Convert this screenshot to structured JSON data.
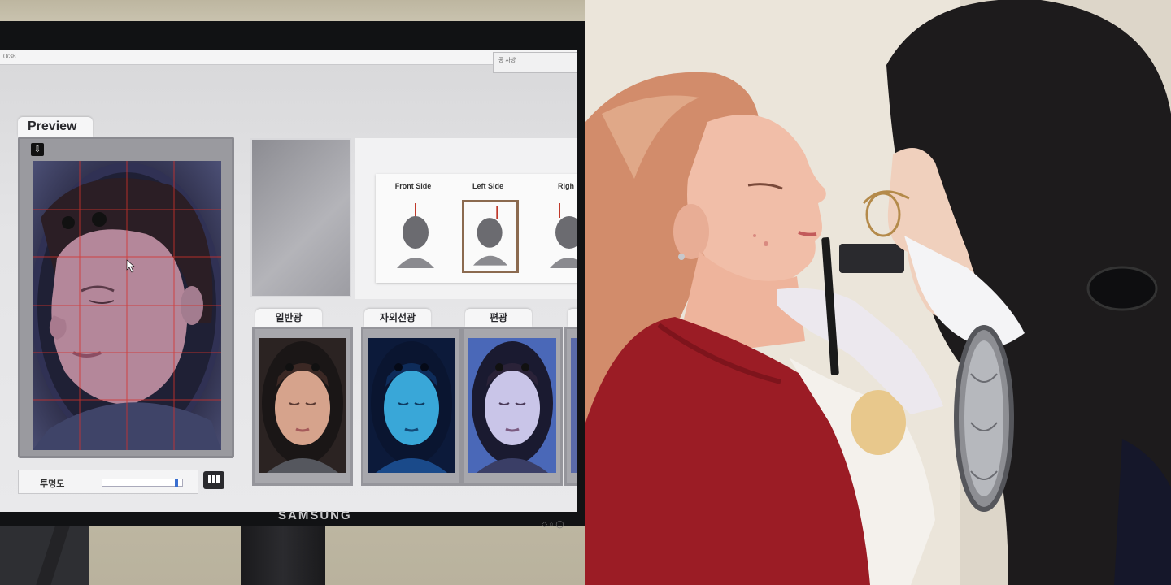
{
  "monitor": {
    "brand": "SAMSUNG",
    "topbar_text": "0/38",
    "topbar_button": "공 사방",
    "preview": {
      "tab_label": "Preview",
      "download_icon": "download-arrow-icon"
    },
    "angles": [
      {
        "label": "Front Side",
        "selected": false
      },
      {
        "label": "Left Side",
        "selected": true
      },
      {
        "label": "Righ",
        "selected": false
      }
    ],
    "light_modes": [
      {
        "label": "일반광",
        "tint": "#d6a38c"
      },
      {
        "label": "자외선광",
        "tint": "#39a7d8"
      },
      {
        "label": "편광",
        "tint": "#c9c5e8"
      },
      {
        "label": "",
        "tint": "#5a6aa8"
      }
    ],
    "opacity": {
      "label": "투명도",
      "value": 0.95
    },
    "grid_icon": "grid-icon"
  },
  "colors": {
    "sweater": "#9b1c25",
    "hair_client": "#d28c6b",
    "hair_staff": "#1d1b1c",
    "wall": "#ebe5da"
  }
}
